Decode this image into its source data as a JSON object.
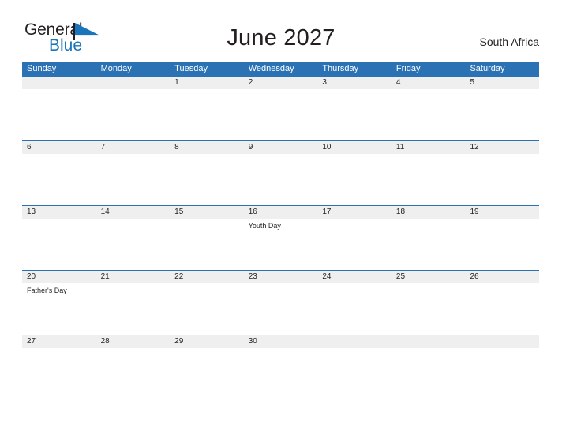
{
  "brand": {
    "name_part1": "General",
    "name_part2": "Blue",
    "flag_icon": "blue-triangle-flag-icon",
    "blue": "#1b75bb"
  },
  "header": {
    "title": "June 2027",
    "country": "South Africa"
  },
  "theme": {
    "header_blue": "#2b72b5",
    "date_band_gray": "#efefef",
    "text": "#231f20"
  },
  "calendar": {
    "day_names": [
      "Sunday",
      "Monday",
      "Tuesday",
      "Wednesday",
      "Thursday",
      "Friday",
      "Saturday"
    ],
    "weeks": [
      [
        {
          "date": "",
          "events": []
        },
        {
          "date": "",
          "events": []
        },
        {
          "date": "1",
          "events": []
        },
        {
          "date": "2",
          "events": []
        },
        {
          "date": "3",
          "events": []
        },
        {
          "date": "4",
          "events": []
        },
        {
          "date": "5",
          "events": []
        }
      ],
      [
        {
          "date": "6",
          "events": []
        },
        {
          "date": "7",
          "events": []
        },
        {
          "date": "8",
          "events": []
        },
        {
          "date": "9",
          "events": []
        },
        {
          "date": "10",
          "events": []
        },
        {
          "date": "11",
          "events": []
        },
        {
          "date": "12",
          "events": []
        }
      ],
      [
        {
          "date": "13",
          "events": []
        },
        {
          "date": "14",
          "events": []
        },
        {
          "date": "15",
          "events": []
        },
        {
          "date": "16",
          "events": [
            "Youth Day"
          ]
        },
        {
          "date": "17",
          "events": []
        },
        {
          "date": "18",
          "events": []
        },
        {
          "date": "19",
          "events": []
        }
      ],
      [
        {
          "date": "20",
          "events": [
            "Father's Day"
          ]
        },
        {
          "date": "21",
          "events": []
        },
        {
          "date": "22",
          "events": []
        },
        {
          "date": "23",
          "events": []
        },
        {
          "date": "24",
          "events": []
        },
        {
          "date": "25",
          "events": []
        },
        {
          "date": "26",
          "events": []
        }
      ],
      [
        {
          "date": "27",
          "events": []
        },
        {
          "date": "28",
          "events": []
        },
        {
          "date": "29",
          "events": []
        },
        {
          "date": "30",
          "events": []
        },
        {
          "date": "",
          "events": []
        },
        {
          "date": "",
          "events": []
        },
        {
          "date": "",
          "events": []
        }
      ]
    ]
  }
}
